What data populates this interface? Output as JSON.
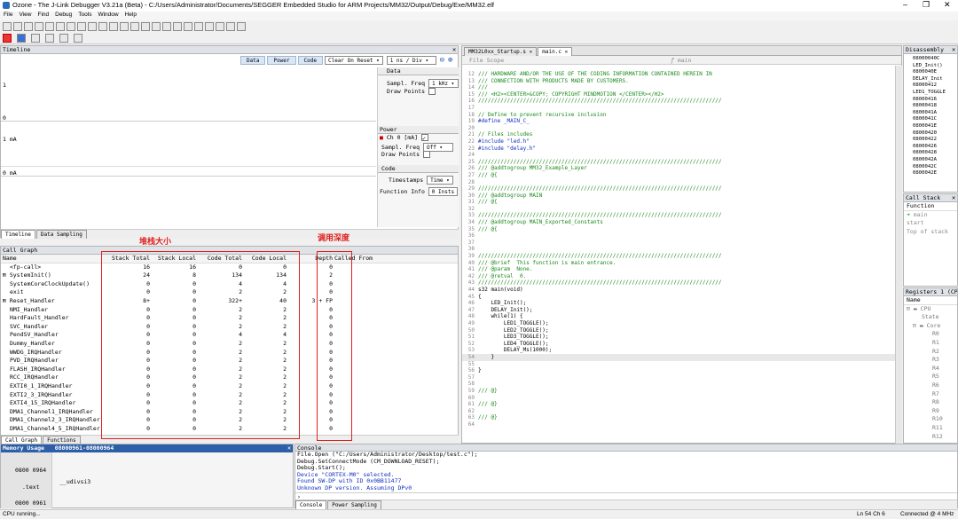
{
  "window": {
    "title": "Ozone - The J-Link Debugger V3.21a (Beta) - C:/Users/Administrator/Documents/SEGGER Embedded Studio for ARM Projects/MM32/Output/Debug/Exe/MM32.elf"
  },
  "menu": [
    "File",
    "View",
    "Find",
    "Debug",
    "Tools",
    "Window",
    "Help"
  ],
  "timeline": {
    "title": "Timeline",
    "buttons": [
      "Data",
      "Power",
      "Code"
    ],
    "clear": "Clear On Reset",
    "zoom": "1 ns / Div",
    "axis1": [
      "1",
      "0"
    ],
    "axis2": [
      "1 mA",
      "0 mA"
    ],
    "data_panel": {
      "title": "Data",
      "sampl_label": "Sampl. Freq",
      "sampl_value": "1 kHz",
      "points_label": "Draw Points"
    },
    "power_panel": {
      "title": "Power",
      "ch_label": "Ch 0 [mA]",
      "sampl_label": "Sampl. Freq",
      "sampl_value": "Off",
      "points_label": "Draw Points"
    },
    "code_panel": {
      "title": "Code",
      "timestamps_label": "Timestamps",
      "timestamps_value": "Time",
      "funcinfo_label": "Function Info",
      "funcinfo_value": "0 Insts"
    },
    "tabs": [
      "Timeline",
      "Data Sampling"
    ]
  },
  "callgraph": {
    "title": "Call Graph",
    "columns": [
      "Name",
      "Stack Total",
      "Stack Local",
      "Code Total",
      "Code Local",
      "Depth",
      "Called From"
    ],
    "rows": [
      {
        "name": "<fp-call>",
        "exp": "",
        "st": "16",
        "sl": "16",
        "ct": "0",
        "cl": "0",
        "d": "0"
      },
      {
        "name": "SystemInit()",
        "exp": "+",
        "st": "24",
        "sl": "8",
        "ct": "134",
        "cl": "134",
        "d": "2"
      },
      {
        "name": "SystemCoreClockUpdate()",
        "exp": "",
        "st": "0",
        "sl": "0",
        "ct": "4",
        "cl": "4",
        "d": "0"
      },
      {
        "name": "exit",
        "exp": "",
        "st": "0",
        "sl": "0",
        "ct": "2",
        "cl": "2",
        "d": "0"
      },
      {
        "name": "Reset_Handler",
        "exp": "+",
        "st": "8+",
        "sl": "0",
        "ct": "322+",
        "cl": "40",
        "d": "3 + FP"
      },
      {
        "name": "NMI_Handler",
        "exp": "",
        "st": "0",
        "sl": "0",
        "ct": "2",
        "cl": "2",
        "d": "0"
      },
      {
        "name": "HardFault_Handler",
        "exp": "",
        "st": "0",
        "sl": "0",
        "ct": "2",
        "cl": "2",
        "d": "0"
      },
      {
        "name": "SVC_Handler",
        "exp": "",
        "st": "0",
        "sl": "0",
        "ct": "2",
        "cl": "2",
        "d": "0"
      },
      {
        "name": "PendSV_Handler",
        "exp": "",
        "st": "0",
        "sl": "0",
        "ct": "4",
        "cl": "4",
        "d": "0"
      },
      {
        "name": "Dummy_Handler",
        "exp": "",
        "st": "0",
        "sl": "0",
        "ct": "2",
        "cl": "2",
        "d": "0"
      },
      {
        "name": "WWDG_IRQHandler",
        "exp": "",
        "st": "0",
        "sl": "0",
        "ct": "2",
        "cl": "2",
        "d": "0"
      },
      {
        "name": "PVD_IRQHandler",
        "exp": "",
        "st": "0",
        "sl": "0",
        "ct": "2",
        "cl": "2",
        "d": "0"
      },
      {
        "name": "FLASH_IRQHandler",
        "exp": "",
        "st": "0",
        "sl": "0",
        "ct": "2",
        "cl": "2",
        "d": "0"
      },
      {
        "name": "RCC_IRQHandler",
        "exp": "",
        "st": "0",
        "sl": "0",
        "ct": "2",
        "cl": "2",
        "d": "0"
      },
      {
        "name": "EXTI0_1_IRQHandler",
        "exp": "",
        "st": "0",
        "sl": "0",
        "ct": "2",
        "cl": "2",
        "d": "0"
      },
      {
        "name": "EXTI2_3_IRQHandler",
        "exp": "",
        "st": "0",
        "sl": "0",
        "ct": "2",
        "cl": "2",
        "d": "0"
      },
      {
        "name": "EXTI4_15_IRQHandler",
        "exp": "",
        "st": "0",
        "sl": "0",
        "ct": "2",
        "cl": "2",
        "d": "0"
      },
      {
        "name": "DMA1_Channel1_IRQHandler",
        "exp": "",
        "st": "0",
        "sl": "0",
        "ct": "2",
        "cl": "2",
        "d": "0"
      },
      {
        "name": "DMA1_Channel2_3_IRQHandler",
        "exp": "",
        "st": "0",
        "sl": "0",
        "ct": "2",
        "cl": "2",
        "d": "0"
      },
      {
        "name": "DMA1_Channel4_5_IRQHandler",
        "exp": "",
        "st": "0",
        "sl": "0",
        "ct": "2",
        "cl": "2",
        "d": "0"
      }
    ],
    "annotation_stack": "堆栈大小",
    "annotation_depth": "调用深度",
    "tabs": [
      "Call Graph",
      "Functions"
    ]
  },
  "memory": {
    "title": "Memory Usage",
    "range": "08000961-08000964",
    "rows": [
      {
        "addr": "0800 0964",
        "label": "",
        "sym": ""
      },
      {
        "addr": ".text",
        "label": "",
        "sym": "__udivsi3"
      },
      {
        "addr": "0800 0961",
        "label": "",
        "sym": ""
      }
    ]
  },
  "editor": {
    "tabs": [
      "MM32L0xx_Startup.s",
      "main.c"
    ],
    "scope": "File Scope",
    "func": "main",
    "lines": [
      {
        "n": "12",
        "t": "/// HARDWARE AND/OR THE USE OF THE CODING INFORMATION CONTAINED HEREIN IN",
        "c": "cm"
      },
      {
        "n": "13",
        "t": "/// CONNECTION WITH PRODUCTS MADE BY CUSTOMERS.",
        "c": "cm"
      },
      {
        "n": "14",
        "t": "///",
        "c": "cm"
      },
      {
        "n": "15",
        "t": "/// <H2><CENTER>&COPY; COPYRIGHT MINDMOTION </CENTER></H2>",
        "c": "cm"
      },
      {
        "n": "16",
        "t": "////////////////////////////////////////////////////////////////////////////",
        "c": "cm"
      },
      {
        "n": "17",
        "t": "",
        "c": ""
      },
      {
        "n": "18",
        "t": "// Define to prevent recursive inclusion",
        "c": "cm"
      },
      {
        "n": "19",
        "t": "#define _MAIN_C_",
        "c": "pp"
      },
      {
        "n": "20",
        "t": "",
        "c": ""
      },
      {
        "n": "21",
        "t": "// Files includes",
        "c": "cm"
      },
      {
        "n": "22",
        "t": "#include \"led.h\"",
        "c": "pp"
      },
      {
        "n": "23",
        "t": "#include \"delay.h\"",
        "c": "pp"
      },
      {
        "n": "24",
        "t": "",
        "c": ""
      },
      {
        "n": "25",
        "t": "////////////////////////////////////////////////////////////////////////////",
        "c": "cm"
      },
      {
        "n": "26",
        "t": "/// @addtogroup MM32_Example_Layer",
        "c": "cm"
      },
      {
        "n": "27",
        "t": "/// @{",
        "c": "cm"
      },
      {
        "n": "28",
        "t": "",
        "c": ""
      },
      {
        "n": "29",
        "t": "////////////////////////////////////////////////////////////////////////////",
        "c": "cm"
      },
      {
        "n": "30",
        "t": "/// @addtogroup MAIN",
        "c": "cm"
      },
      {
        "n": "31",
        "t": "/// @{",
        "c": "cm"
      },
      {
        "n": "32",
        "t": "",
        "c": ""
      },
      {
        "n": "33",
        "t": "////////////////////////////////////////////////////////////////////////////",
        "c": "cm"
      },
      {
        "n": "34",
        "t": "/// @addtogroup MAIN_Exported_Constants",
        "c": "cm"
      },
      {
        "n": "35",
        "t": "/// @{",
        "c": "cm"
      },
      {
        "n": "36",
        "t": "",
        "c": ""
      },
      {
        "n": "37",
        "t": "",
        "c": ""
      },
      {
        "n": "38",
        "t": "",
        "c": ""
      },
      {
        "n": "39",
        "t": "////////////////////////////////////////////////////////////////////////////",
        "c": "cm"
      },
      {
        "n": "40",
        "t": "/// @brief  This function is main entrance.",
        "c": "cm"
      },
      {
        "n": "41",
        "t": "/// @param  None.",
        "c": "cm"
      },
      {
        "n": "42",
        "t": "/// @retval  0.",
        "c": "cm"
      },
      {
        "n": "43",
        "t": "////////////////////////////////////////////////////////////////////////////",
        "c": "cm"
      },
      {
        "n": "44",
        "t": "s32 main(void)",
        "c": ""
      },
      {
        "n": "45",
        "t": "{",
        "c": ""
      },
      {
        "n": "46",
        "t": "    LED_Init();",
        "c": ""
      },
      {
        "n": "47",
        "t": "    DELAY_Init();",
        "c": ""
      },
      {
        "n": "48",
        "t": "    while(1) {",
        "c": ""
      },
      {
        "n": "49",
        "t": "        LED1_TOGGLE();",
        "c": ""
      },
      {
        "n": "50",
        "t": "        LED2_TOGGLE();",
        "c": ""
      },
      {
        "n": "51",
        "t": "        LED3_TOGGLE();",
        "c": ""
      },
      {
        "n": "52",
        "t": "        LED4_TOGGLE();",
        "c": ""
      },
      {
        "n": "53",
        "t": "        DELAY_Ms(1000);",
        "c": ""
      },
      {
        "n": "54",
        "t": "    }",
        "c": ""
      },
      {
        "n": "55",
        "t": "",
        "c": ""
      },
      {
        "n": "56",
        "t": "}",
        "c": ""
      },
      {
        "n": "57",
        "t": "",
        "c": ""
      },
      {
        "n": "58",
        "t": "",
        "c": ""
      },
      {
        "n": "59",
        "t": "/// @}",
        "c": "cm"
      },
      {
        "n": "60",
        "t": "",
        "c": ""
      },
      {
        "n": "61",
        "t": "/// @}",
        "c": "cm"
      },
      {
        "n": "62",
        "t": "",
        "c": ""
      },
      {
        "n": "63",
        "t": "/// @}",
        "c": "cm"
      },
      {
        "n": "64",
        "t": "",
        "c": ""
      }
    ]
  },
  "disassembly": {
    "title": "Disassembly",
    "lines": [
      "08000040C",
      "LED_Init()",
      "0800040E",
      "DELAY_Init",
      "08000412",
      "LED1_TOGGLE",
      "08000416",
      "08000418",
      "0800041A",
      "0800041C",
      "0800041E",
      "08000420",
      "08000422",
      "08000426",
      "08000428",
      "0800042A",
      "0800042C",
      "0800042E"
    ]
  },
  "callstack": {
    "title": "Call Stack",
    "header": "Function",
    "rows": [
      "main",
      "start",
      "Top of stack"
    ]
  },
  "registers": {
    "title": "Registers 1 (CPU)",
    "header": "Name",
    "groups": [
      "CPU",
      "State",
      "Core"
    ],
    "regs": [
      "R0",
      "R1",
      "R2",
      "R3",
      "R4",
      "R5",
      "R6",
      "R7",
      "R8",
      "R9",
      "R10",
      "R11",
      "R12"
    ]
  },
  "console": {
    "title": "Console",
    "lines": [
      {
        "t": "File.Open (\"C:/Users/Administrator/Desktop/test.c\");",
        "c": ""
      },
      {
        "t": "Debug.SetConnectMode (CM_DOWNLOAD_RESET);",
        "c": ""
      },
      {
        "t": "Debug.Start();",
        "c": ""
      },
      {
        "t": "Device \"CORTEX-M0\" selected.",
        "c": "kw"
      },
      {
        "t": "Found SW-DP with ID 0x0BB11477",
        "c": "kw"
      },
      {
        "t": "Unknown DP version. Assuming DPv0",
        "c": "kw"
      }
    ],
    "tabs": [
      "Console",
      "Power Sampling"
    ]
  },
  "status": {
    "left": "CPU running...",
    "pos": "Ln 54  Ch 6",
    "conn": "Connected @ 4 MHz"
  }
}
